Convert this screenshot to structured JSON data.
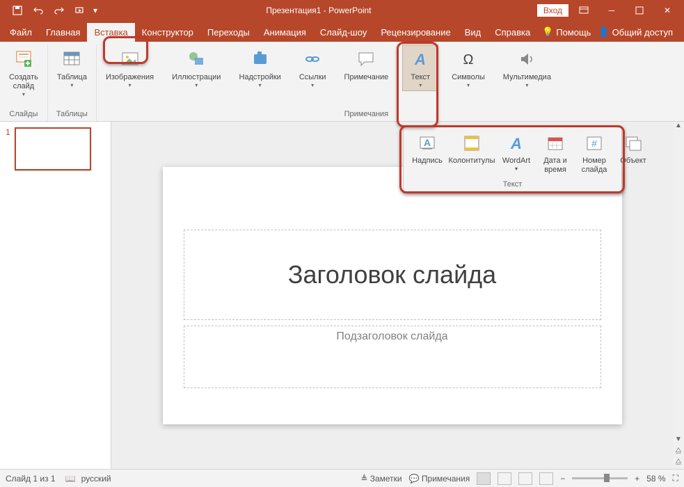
{
  "title": "Презентация1 - PowerPoint",
  "login": "Вход",
  "tabs": {
    "file": "Файл",
    "home": "Главная",
    "insert": "Вставка",
    "design": "Конструктор",
    "transitions": "Переходы",
    "animation": "Анимация",
    "slideshow": "Слайд-шоу",
    "review": "Рецензирование",
    "view": "Вид",
    "help": "Справка"
  },
  "tabs_right": {
    "help": "Помощь",
    "share": "Общий доступ"
  },
  "ribbon": {
    "new_slide": "Создать\nслайд",
    "slides_group": "Слайды",
    "table": "Таблица",
    "tables_group": "Таблицы",
    "images": "Изображения",
    "illustrations": "Иллюстрации",
    "addins": "Надстройки",
    "links": "Ссылки",
    "comment": "Примечание",
    "comments_group": "Примечания",
    "text": "Текст",
    "symbols": "Символы",
    "media": "Мультимедиа"
  },
  "flyout": {
    "textbox": "Надпись",
    "headerfooter": "Колонтитулы",
    "wordart": "WordArt",
    "datetime": "Дата и\nвремя",
    "slidenum": "Номер\nслайда",
    "object": "Объект",
    "group": "Текст"
  },
  "slide": {
    "num": "1",
    "title": "Заголовок слайда",
    "subtitle": "Подзаголовок слайда"
  },
  "status": {
    "slide": "Слайд 1 из 1",
    "lang": "русский",
    "notes": "Заметки",
    "comments": "Примечания",
    "zoom": "58 %"
  }
}
